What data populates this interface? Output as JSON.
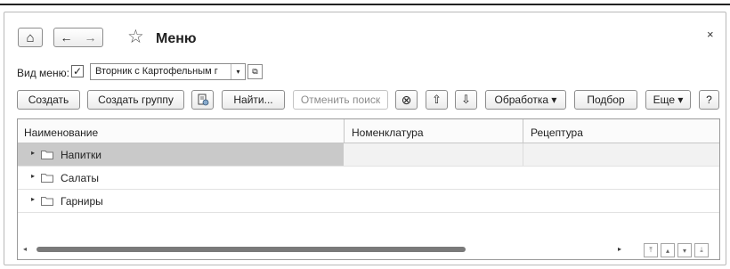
{
  "window": {
    "title": "Меню",
    "close_glyph": "×"
  },
  "nav": {
    "home_icon": "⌂",
    "back_icon": "←",
    "forward_icon": "→",
    "star_icon": "☆"
  },
  "filter": {
    "label": "Вид меню:",
    "checked_glyph": "✓",
    "value": "Вторник с Картофельным г",
    "dropdown_glyph": "▾",
    "open_glyph": "⧉"
  },
  "toolbar": {
    "create": "Создать",
    "create_group": "Создать группу",
    "find": "Найти...",
    "cancel_search": "Отменить поиск",
    "clear_icon": "⊗",
    "up_icon": "⇧",
    "down_icon": "⇩",
    "processing": "Обработка ▾",
    "selection": "Подбор",
    "more": "Еще ▾",
    "help": "?"
  },
  "table": {
    "columns": [
      "Наименование",
      "Номенклатура",
      "Рецептура"
    ],
    "rows": [
      {
        "name": "Напитки",
        "nomenclature": "",
        "recipe": ""
      },
      {
        "name": "Салаты",
        "nomenclature": "",
        "recipe": ""
      },
      {
        "name": "Гарниры",
        "nomenclature": "",
        "recipe": ""
      }
    ],
    "expand_glyph": "▸"
  },
  "scroll": {
    "left_glyph": "◂",
    "right_glyph": "▸",
    "first_glyph": "⤒",
    "up_glyph": "▴",
    "down_glyph": "▾",
    "last_glyph": "⤓"
  }
}
